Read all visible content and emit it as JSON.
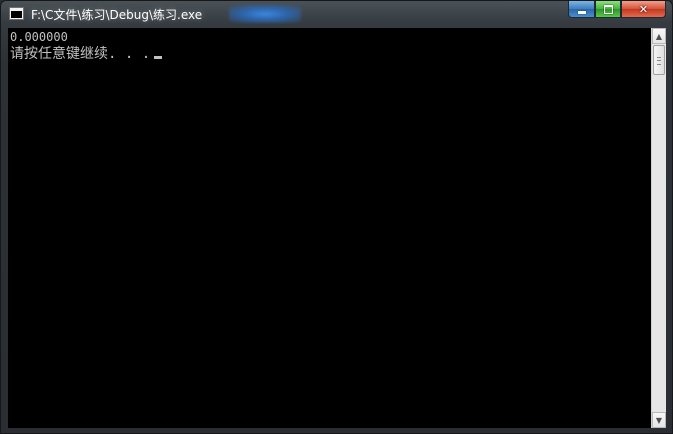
{
  "window": {
    "title": "F:\\C文件\\练习\\Debug\\练习.exe"
  },
  "caption_buttons": {
    "minimize_glyph": "minimize-icon",
    "maximize_glyph": "maximize-icon",
    "close_glyph": "✕"
  },
  "console": {
    "lines": [
      "0.000000",
      "请按任意键继续. . ."
    ]
  },
  "scrollbar": {
    "up_arrow": "▲",
    "down_arrow": "▼"
  },
  "colors": {
    "console_background": "#000000",
    "console_text": "#c0c0c0",
    "close_button": "#c2391f",
    "maximize_button": "#46b13c",
    "minimize_button": "#3c7dbd"
  }
}
